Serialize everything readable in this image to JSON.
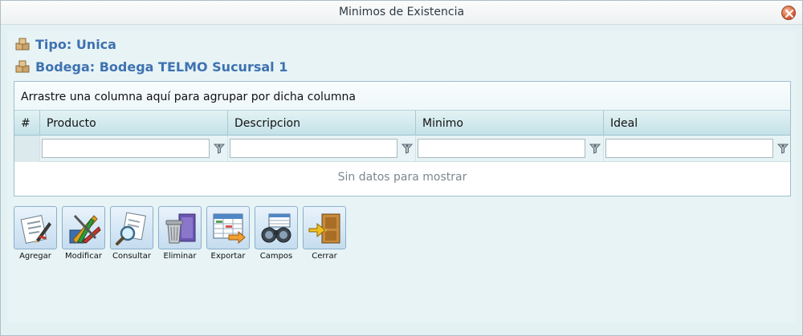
{
  "window": {
    "title": "Minimos de Existencia"
  },
  "info": {
    "tipo": "Tipo: Unica",
    "bodega": "Bodega: Bodega TELMO Sucursal 1"
  },
  "grid": {
    "group_hint": "Arrastre una columna aquí para agrupar por dicha columna",
    "columns": [
      "#",
      "Producto",
      "Descripcion",
      "Minimo",
      "Ideal"
    ],
    "empty_text": "Sin datos para mostrar"
  },
  "toolbar": {
    "buttons": [
      {
        "label": "Agregar",
        "icon": "add-document-icon"
      },
      {
        "label": "Modificar",
        "icon": "edit-pencils-icon"
      },
      {
        "label": "Consultar",
        "icon": "magnifier-document-icon"
      },
      {
        "label": "Eliminar",
        "icon": "trash-can-icon"
      },
      {
        "label": "Exportar",
        "icon": "export-spreadsheet-icon"
      },
      {
        "label": "Campos",
        "icon": "binoculars-icon"
      },
      {
        "label": "Cerrar",
        "icon": "exit-door-icon"
      }
    ]
  }
}
